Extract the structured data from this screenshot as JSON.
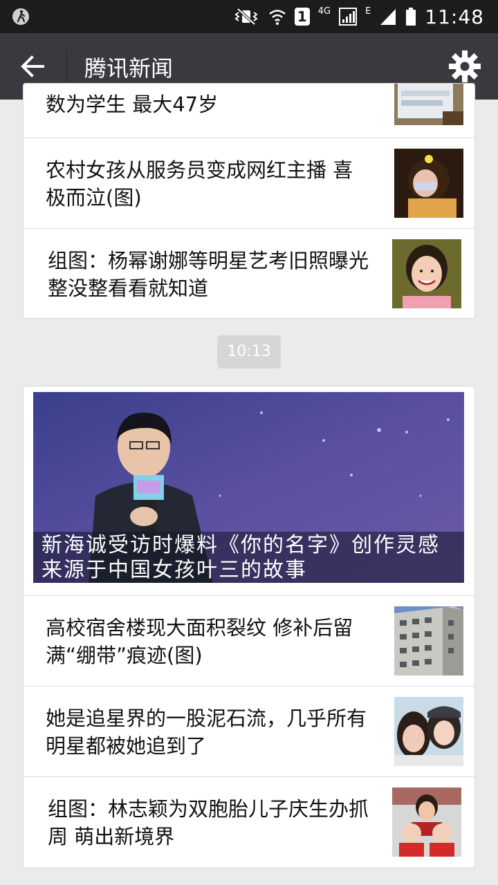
{
  "status_bar": {
    "time": "11:48",
    "sim_label": "1",
    "network_4g": "4G",
    "network_e": "E"
  },
  "header": {
    "title": "腾讯新闻"
  },
  "card_top": {
    "items": [
      {
        "title": "数为学生 最大47岁",
        "thumb": "stack-of-papers-photo"
      },
      {
        "title": "农村女孩从服务员变成网红主播 喜极而泣(图)",
        "thumb": "crying-girl-photo"
      },
      {
        "title": "组图：杨幂谢娜等明星艺考旧照曝光 整没整看看就知道",
        "thumb": "smiling-girl-photo"
      }
    ]
  },
  "time_badge": "10:13",
  "card_bottom": {
    "hero_caption": "新海诚受访时爆料《你的名字》创作灵感来源于中国女孩叶三的故事",
    "items": [
      {
        "title": "高校宿舍楼现大面积裂纹 修补后留满“绷带”痕迹(图)",
        "thumb": "building-photo"
      },
      {
        "title": "她是追星界的一股泥石流，几乎所有明星都被她追到了",
        "thumb": "two-women-selfie-photo"
      },
      {
        "title": "组图：林志颖为双胞胎儿子庆生办抓周 萌出新境界",
        "thumb": "father-twins-photo"
      }
    ]
  }
}
